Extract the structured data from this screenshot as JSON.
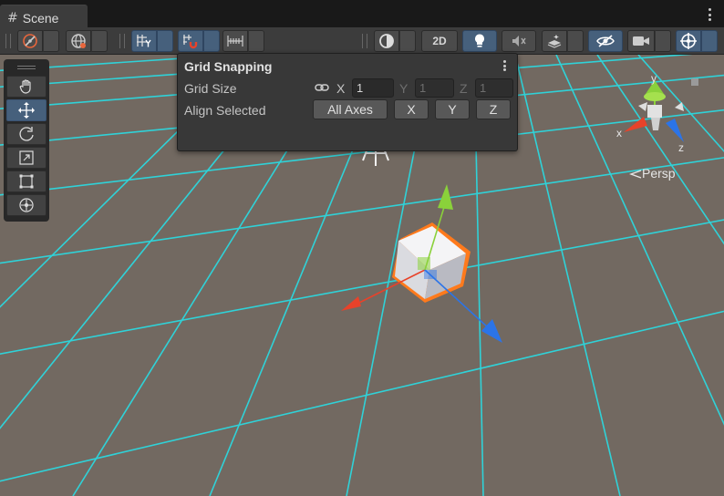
{
  "tab": {
    "title": "Scene",
    "icon": "hash-icon"
  },
  "toolbar": {
    "draw_mode": "gizmo-draw-icon",
    "global_local": "globe-icon",
    "grid_toggle": "grid-y-icon",
    "snap_toggle": "magnet-grid-icon",
    "increment_snap": "ruler-icon",
    "shading": "sphere-shading-icon",
    "two_d_label": "2D",
    "lighting": "lightbulb-icon",
    "audio": "audio-mute-icon",
    "effects": "effects-stack-icon",
    "visibility": "eye-slash-icon",
    "camera": "camera-icon",
    "gizmos": "gizmo-crosshair-icon"
  },
  "tools": [
    {
      "name": "hand-tool",
      "icon": "hand-icon",
      "active": false
    },
    {
      "name": "move-tool",
      "icon": "move-arrows-icon",
      "active": true
    },
    {
      "name": "rotate-tool",
      "icon": "rotate-icon",
      "active": false
    },
    {
      "name": "scale-tool",
      "icon": "scale-icon",
      "active": false
    },
    {
      "name": "rect-tool",
      "icon": "rect-icon",
      "active": false
    },
    {
      "name": "transform-tool",
      "icon": "transform-icon",
      "active": false
    }
  ],
  "grid_snapping": {
    "title": "Grid Snapping",
    "grid_size_label": "Grid Size",
    "axis_x": "X",
    "axis_y": "Y",
    "axis_z": "Z",
    "x_value": "1",
    "y_value": "1",
    "z_value": "1",
    "align_label": "Align Selected",
    "all_axes": "All Axes",
    "btn_x": "X",
    "btn_y": "Y",
    "btn_z": "Z"
  },
  "orientation_gizmo": {
    "x_label": "x",
    "y_label": "y",
    "z_label": "z",
    "projection": "Persp"
  },
  "colors": {
    "grid_line": "#2fd2d8",
    "ground": "#726961",
    "selection_outline": "#ff7a1c",
    "axis_x": "#e8422a",
    "axis_y": "#8ad13a",
    "axis_z": "#2b74e8",
    "toolbar_active": "#46607c"
  }
}
